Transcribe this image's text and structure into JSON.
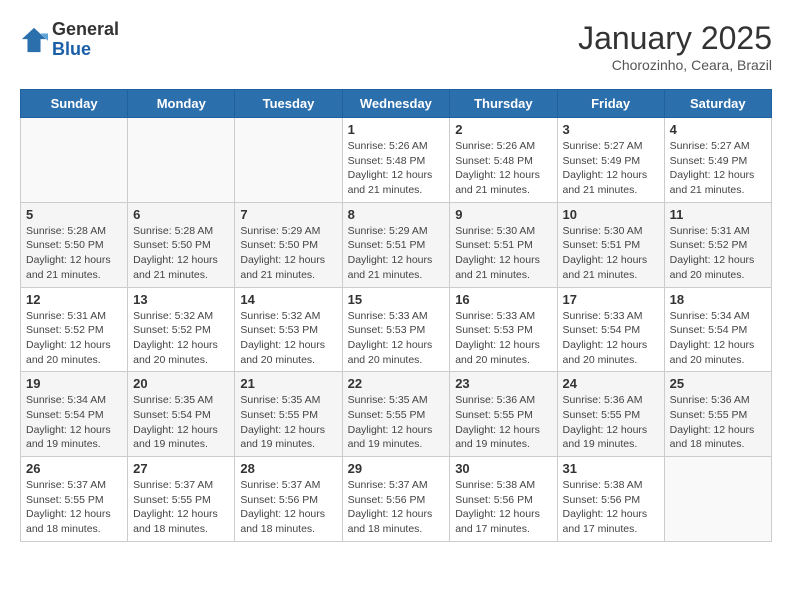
{
  "header": {
    "logo_general": "General",
    "logo_blue": "Blue",
    "month_title": "January 2025",
    "location": "Chorozinho, Ceara, Brazil"
  },
  "weekdays": [
    "Sunday",
    "Monday",
    "Tuesday",
    "Wednesday",
    "Thursday",
    "Friday",
    "Saturday"
  ],
  "weeks": [
    [
      {
        "day": "",
        "sunrise": "",
        "sunset": "",
        "daylight": ""
      },
      {
        "day": "",
        "sunrise": "",
        "sunset": "",
        "daylight": ""
      },
      {
        "day": "",
        "sunrise": "",
        "sunset": "",
        "daylight": ""
      },
      {
        "day": "1",
        "sunrise": "Sunrise: 5:26 AM",
        "sunset": "Sunset: 5:48 PM",
        "daylight": "Daylight: 12 hours and 21 minutes."
      },
      {
        "day": "2",
        "sunrise": "Sunrise: 5:26 AM",
        "sunset": "Sunset: 5:48 PM",
        "daylight": "Daylight: 12 hours and 21 minutes."
      },
      {
        "day": "3",
        "sunrise": "Sunrise: 5:27 AM",
        "sunset": "Sunset: 5:49 PM",
        "daylight": "Daylight: 12 hours and 21 minutes."
      },
      {
        "day": "4",
        "sunrise": "Sunrise: 5:27 AM",
        "sunset": "Sunset: 5:49 PM",
        "daylight": "Daylight: 12 hours and 21 minutes."
      }
    ],
    [
      {
        "day": "5",
        "sunrise": "Sunrise: 5:28 AM",
        "sunset": "Sunset: 5:50 PM",
        "daylight": "Daylight: 12 hours and 21 minutes."
      },
      {
        "day": "6",
        "sunrise": "Sunrise: 5:28 AM",
        "sunset": "Sunset: 5:50 PM",
        "daylight": "Daylight: 12 hours and 21 minutes."
      },
      {
        "day": "7",
        "sunrise": "Sunrise: 5:29 AM",
        "sunset": "Sunset: 5:50 PM",
        "daylight": "Daylight: 12 hours and 21 minutes."
      },
      {
        "day": "8",
        "sunrise": "Sunrise: 5:29 AM",
        "sunset": "Sunset: 5:51 PM",
        "daylight": "Daylight: 12 hours and 21 minutes."
      },
      {
        "day": "9",
        "sunrise": "Sunrise: 5:30 AM",
        "sunset": "Sunset: 5:51 PM",
        "daylight": "Daylight: 12 hours and 21 minutes."
      },
      {
        "day": "10",
        "sunrise": "Sunrise: 5:30 AM",
        "sunset": "Sunset: 5:51 PM",
        "daylight": "Daylight: 12 hours and 21 minutes."
      },
      {
        "day": "11",
        "sunrise": "Sunrise: 5:31 AM",
        "sunset": "Sunset: 5:52 PM",
        "daylight": "Daylight: 12 hours and 20 minutes."
      }
    ],
    [
      {
        "day": "12",
        "sunrise": "Sunrise: 5:31 AM",
        "sunset": "Sunset: 5:52 PM",
        "daylight": "Daylight: 12 hours and 20 minutes."
      },
      {
        "day": "13",
        "sunrise": "Sunrise: 5:32 AM",
        "sunset": "Sunset: 5:52 PM",
        "daylight": "Daylight: 12 hours and 20 minutes."
      },
      {
        "day": "14",
        "sunrise": "Sunrise: 5:32 AM",
        "sunset": "Sunset: 5:53 PM",
        "daylight": "Daylight: 12 hours and 20 minutes."
      },
      {
        "day": "15",
        "sunrise": "Sunrise: 5:33 AM",
        "sunset": "Sunset: 5:53 PM",
        "daylight": "Daylight: 12 hours and 20 minutes."
      },
      {
        "day": "16",
        "sunrise": "Sunrise: 5:33 AM",
        "sunset": "Sunset: 5:53 PM",
        "daylight": "Daylight: 12 hours and 20 minutes."
      },
      {
        "day": "17",
        "sunrise": "Sunrise: 5:33 AM",
        "sunset": "Sunset: 5:54 PM",
        "daylight": "Daylight: 12 hours and 20 minutes."
      },
      {
        "day": "18",
        "sunrise": "Sunrise: 5:34 AM",
        "sunset": "Sunset: 5:54 PM",
        "daylight": "Daylight: 12 hours and 20 minutes."
      }
    ],
    [
      {
        "day": "19",
        "sunrise": "Sunrise: 5:34 AM",
        "sunset": "Sunset: 5:54 PM",
        "daylight": "Daylight: 12 hours and 19 minutes."
      },
      {
        "day": "20",
        "sunrise": "Sunrise: 5:35 AM",
        "sunset": "Sunset: 5:54 PM",
        "daylight": "Daylight: 12 hours and 19 minutes."
      },
      {
        "day": "21",
        "sunrise": "Sunrise: 5:35 AM",
        "sunset": "Sunset: 5:55 PM",
        "daylight": "Daylight: 12 hours and 19 minutes."
      },
      {
        "day": "22",
        "sunrise": "Sunrise: 5:35 AM",
        "sunset": "Sunset: 5:55 PM",
        "daylight": "Daylight: 12 hours and 19 minutes."
      },
      {
        "day": "23",
        "sunrise": "Sunrise: 5:36 AM",
        "sunset": "Sunset: 5:55 PM",
        "daylight": "Daylight: 12 hours and 19 minutes."
      },
      {
        "day": "24",
        "sunrise": "Sunrise: 5:36 AM",
        "sunset": "Sunset: 5:55 PM",
        "daylight": "Daylight: 12 hours and 19 minutes."
      },
      {
        "day": "25",
        "sunrise": "Sunrise: 5:36 AM",
        "sunset": "Sunset: 5:55 PM",
        "daylight": "Daylight: 12 hours and 18 minutes."
      }
    ],
    [
      {
        "day": "26",
        "sunrise": "Sunrise: 5:37 AM",
        "sunset": "Sunset: 5:55 PM",
        "daylight": "Daylight: 12 hours and 18 minutes."
      },
      {
        "day": "27",
        "sunrise": "Sunrise: 5:37 AM",
        "sunset": "Sunset: 5:55 PM",
        "daylight": "Daylight: 12 hours and 18 minutes."
      },
      {
        "day": "28",
        "sunrise": "Sunrise: 5:37 AM",
        "sunset": "Sunset: 5:56 PM",
        "daylight": "Daylight: 12 hours and 18 minutes."
      },
      {
        "day": "29",
        "sunrise": "Sunrise: 5:37 AM",
        "sunset": "Sunset: 5:56 PM",
        "daylight": "Daylight: 12 hours and 18 minutes."
      },
      {
        "day": "30",
        "sunrise": "Sunrise: 5:38 AM",
        "sunset": "Sunset: 5:56 PM",
        "daylight": "Daylight: 12 hours and 17 minutes."
      },
      {
        "day": "31",
        "sunrise": "Sunrise: 5:38 AM",
        "sunset": "Sunset: 5:56 PM",
        "daylight": "Daylight: 12 hours and 17 minutes."
      },
      {
        "day": "",
        "sunrise": "",
        "sunset": "",
        "daylight": ""
      }
    ]
  ]
}
